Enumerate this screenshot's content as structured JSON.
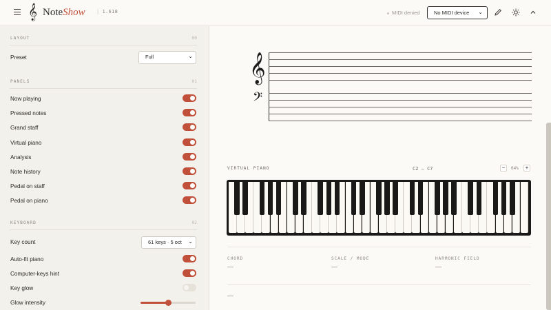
{
  "header": {
    "brand_note": "Note",
    "brand_show": "Show",
    "version": "1.618",
    "midi_status": "MIDI denied",
    "midi_device": "No MIDI device"
  },
  "sidebar": {
    "layout": {
      "title": "LAYOUT",
      "num": "00",
      "preset_label": "Preset",
      "preset_value": "Full"
    },
    "panels": {
      "title": "PANELS",
      "num": "01",
      "items": [
        {
          "label": "Now playing",
          "on": true
        },
        {
          "label": "Pressed notes",
          "on": true
        },
        {
          "label": "Grand staff",
          "on": true
        },
        {
          "label": "Virtual piano",
          "on": true
        },
        {
          "label": "Analysis",
          "on": true
        },
        {
          "label": "Note history",
          "on": true
        },
        {
          "label": "Pedal on staff",
          "on": true
        },
        {
          "label": "Pedal on piano",
          "on": true
        }
      ]
    },
    "keyboard": {
      "title": "KEYBOARD",
      "num": "02",
      "key_count_label": "Key count",
      "key_count_value": "61 keys · 5 oct",
      "items": [
        {
          "label": "Auto-fit piano",
          "on": true
        },
        {
          "label": "Computer-keys hint",
          "on": true
        },
        {
          "label": "Key glow",
          "on": false
        }
      ],
      "glow_label": "Glow intensity",
      "glow_value": 0.5
    }
  },
  "main": {
    "virtual_piano": {
      "title": "VIRTUAL PIANO",
      "range": "C2 – C7",
      "zoom_minus": "−",
      "zoom_value": "64%",
      "zoom_plus": "+"
    },
    "analysis": {
      "chord_label": "CHORD",
      "chord_value": "—",
      "scale_label": "SCALE / MODE",
      "scale_value": "—",
      "harmonic_label": "HARMONIC FIELD",
      "harmonic_value": "—"
    },
    "history_value": "—"
  },
  "colors": {
    "accent": "#c0503a",
    "background": "#fbfaf7",
    "sidebar": "#f3f1ec"
  }
}
